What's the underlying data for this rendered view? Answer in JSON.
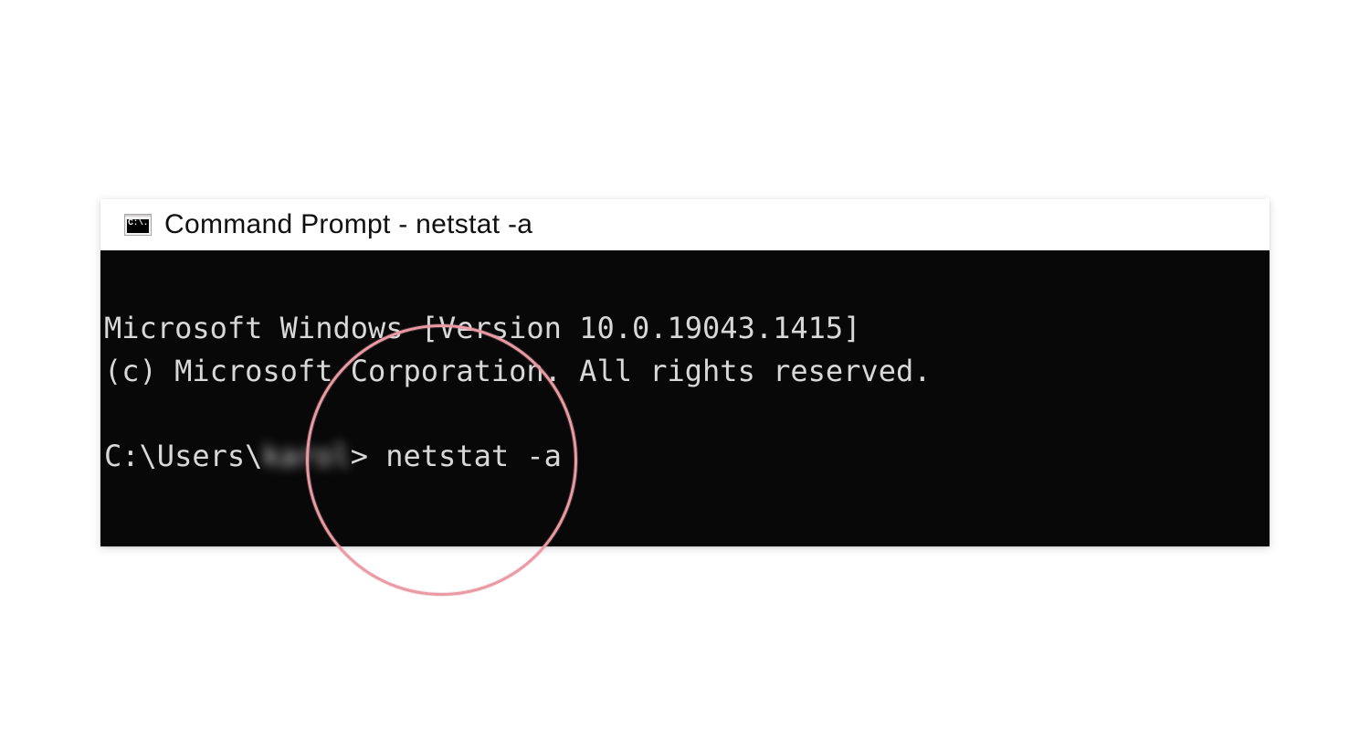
{
  "window": {
    "title": "Command Prompt - netstat  -a",
    "icon_glyph": "C:\\."
  },
  "terminal": {
    "line1": "Microsoft Windows [Version 10.0.19043.1415]",
    "line2": "(c) Microsoft Corporation. All rights reserved.",
    "blank": "",
    "prompt_prefix": "C:\\Users\\",
    "prompt_user": "karol",
    "prompt_suffix": "> ",
    "command": "netstat -a"
  }
}
